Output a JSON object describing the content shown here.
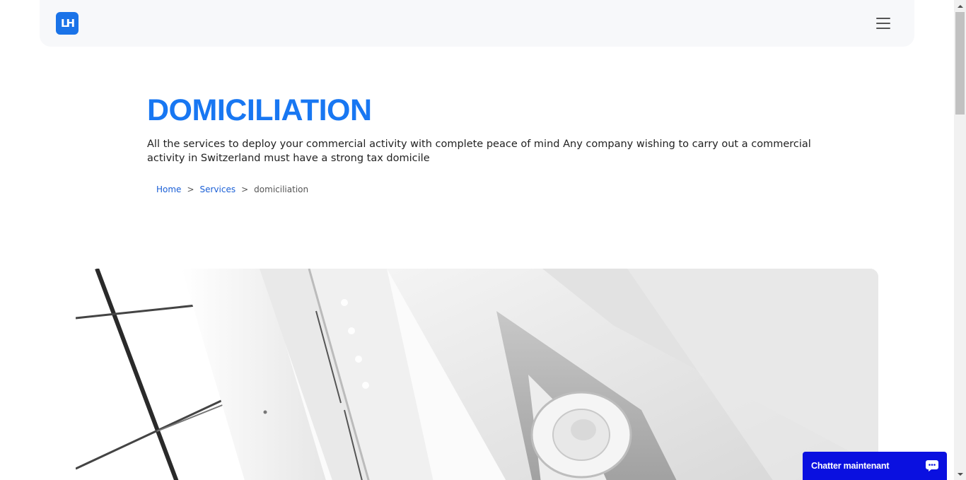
{
  "header": {
    "logo_text": "LH",
    "icons": {
      "logo": "brand-logo",
      "menu": "hamburger-menu-icon"
    }
  },
  "hero": {
    "title": "DOMICILIATION",
    "lead": "All the services to deploy your commercial activity with complete peace of mind Any company wishing to carry out a commercial activity in Switzerland must have a strong tax domicile"
  },
  "breadcrumb": {
    "items": [
      "Home",
      "Services",
      "domiciliation"
    ],
    "separator": ">"
  },
  "chat": {
    "label": "Chatter maintenant",
    "icon": "chat-bubble-icon"
  },
  "colors": {
    "accent": "#1877f2",
    "chat_bg": "#0a10e0",
    "header_bg": "#f7f8fa"
  }
}
